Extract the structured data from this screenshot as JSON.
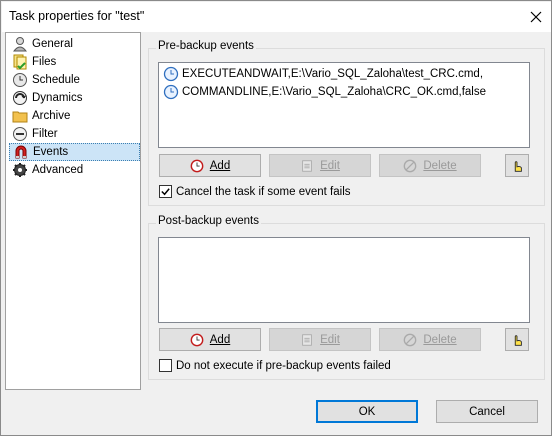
{
  "window": {
    "title": "Task properties for \"test\""
  },
  "nav": {
    "items": [
      {
        "label": "General",
        "icon": "person-icon"
      },
      {
        "label": "Files",
        "icon": "files-icon"
      },
      {
        "label": "Schedule",
        "icon": "schedule-clock-icon"
      },
      {
        "label": "Dynamics",
        "icon": "dynamics-icon"
      },
      {
        "label": "Archive",
        "icon": "archive-folder-icon"
      },
      {
        "label": "Filter",
        "icon": "filter-icon"
      },
      {
        "label": "Events",
        "icon": "magnet-icon",
        "selected": true
      },
      {
        "label": "Advanced",
        "icon": "gear-icon"
      }
    ]
  },
  "pre_backup": {
    "title": "Pre-backup events",
    "events": [
      "EXECUTEANDWAIT,E:\\Vario_SQL_Zaloha\\test_CRC.cmd,",
      "COMMANDLINE,E:\\Vario_SQL_Zaloha\\CRC_OK.cmd,false"
    ],
    "add_label": "Add",
    "edit_label": "Edit",
    "delete_label": "Delete",
    "checkbox_label": "Cancel the task if some event fails",
    "checkbox_checked": true
  },
  "post_backup": {
    "title": "Post-backup events",
    "events": [],
    "add_label": "Add",
    "edit_label": "Edit",
    "delete_label": "Delete",
    "checkbox_label": "Do not execute if pre-backup events failed",
    "checkbox_checked": false
  },
  "footer": {
    "ok_label": "OK",
    "cancel_label": "Cancel"
  }
}
